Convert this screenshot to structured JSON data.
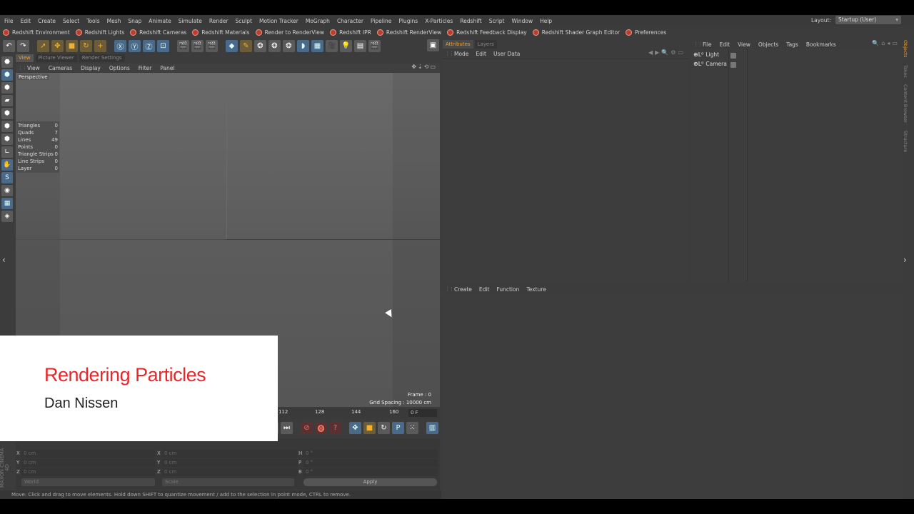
{
  "menubar": {
    "items": [
      "File",
      "Edit",
      "Create",
      "Select",
      "Tools",
      "Mesh",
      "Snap",
      "Animate",
      "Simulate",
      "Render",
      "Sculpt",
      "Motion Tracker",
      "MoGraph",
      "Character",
      "Pipeline",
      "Plugins",
      "X-Particles",
      "Redshift",
      "Script",
      "Window",
      "Help"
    ],
    "layout_label": "Layout:",
    "layout_value": "Startup (User)"
  },
  "redshift_bar": [
    "Redshift Environment",
    "Redshift Lights",
    "Redshift Cameras",
    "Redshift Materials",
    "Render to RenderView",
    "Redshift IPR",
    "Redshift RenderView",
    "Redshift Feedback Display",
    "Redshift Shader Graph Editor",
    "Preferences"
  ],
  "viewport": {
    "tabs": [
      "View",
      "Picture Viewer",
      "Render Settings"
    ],
    "menu": [
      "View",
      "Cameras",
      "Display",
      "Options",
      "Filter",
      "Panel"
    ],
    "label": "Perspective",
    "stats": [
      {
        "k": "Triangles",
        "v": "0"
      },
      {
        "k": "Quads",
        "v": "7"
      },
      {
        "k": "Lines",
        "v": "49"
      },
      {
        "k": "Points",
        "v": "0"
      },
      {
        "k": "Triangle Strips",
        "v": "0"
      },
      {
        "k": "Line Strips",
        "v": "0"
      },
      {
        "k": "Layer",
        "v": "0"
      }
    ],
    "frame": "Frame : 0",
    "grid_spacing": "Grid Spacing : 10000 cm"
  },
  "timeline": {
    "ticks": [
      "112",
      "128",
      "144",
      "160"
    ],
    "frame_field": "0 F"
  },
  "coords": {
    "rows": [
      {
        "a": "X",
        "av": "0 cm",
        "b": "X",
        "bv": "0 cm",
        "c": "H",
        "cv": "0 °"
      },
      {
        "a": "Y",
        "av": "0 cm",
        "b": "Y",
        "bv": "0 cm",
        "c": "P",
        "cv": "0 °"
      },
      {
        "a": "Z",
        "av": "0 cm",
        "b": "Z",
        "bv": "0 cm",
        "c": "B",
        "cv": "0 °"
      }
    ],
    "space": "World",
    "mode": "Scale",
    "apply": "Apply"
  },
  "status": "Move: Click and drag to move elements. Hold down SHIFT to quantize movement / add to the selection in point mode, CTRL to remove.",
  "branding": "MAXON CINEMA 4D",
  "attributes": {
    "tabs": [
      "Attributes",
      "Layers"
    ],
    "menu": [
      "Mode",
      "Edit",
      "User Data"
    ]
  },
  "objects": {
    "menu": [
      "File",
      "Edit",
      "View",
      "Objects",
      "Tags",
      "Bookmarks"
    ],
    "items": [
      "Light",
      "Camera"
    ]
  },
  "right_tabs": [
    "Objects",
    "Takes",
    "Content Browser",
    "Structure"
  ],
  "material": {
    "menu": [
      "Create",
      "Edit",
      "Function",
      "Texture"
    ]
  },
  "title_card": {
    "title": "Rendering Particles",
    "author": "Dan Nissen"
  },
  "colors": {
    "accent": "#f0a030",
    "card_title": "#e8262b",
    "axis_y": "#3d8a3d",
    "axis_z": "#2f35b0"
  }
}
